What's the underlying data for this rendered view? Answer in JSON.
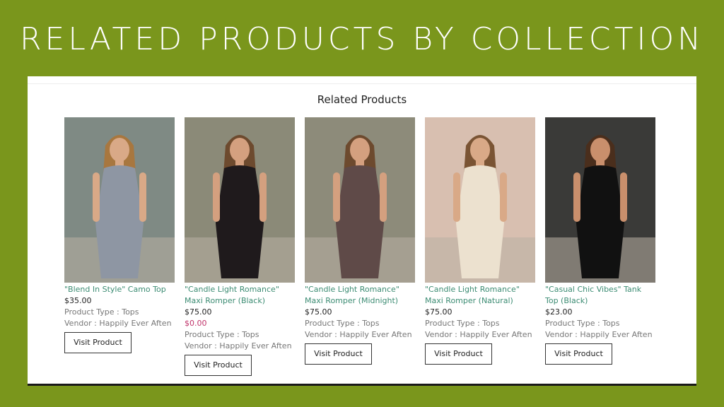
{
  "banner": {
    "title": "RELATED PRODUCTS BY COLLECTION"
  },
  "section": {
    "heading": "Related Products"
  },
  "products": [
    {
      "title": "\"Blend In Style\" Camo Top",
      "price": "$35.00",
      "compare_price": null,
      "product_type": "Product Type : Tops",
      "vendor": "Vendor : Happily Ever Aften",
      "button": "Visit Product",
      "colors": {
        "bg": "#7f8a84",
        "garment": "#8e96a3",
        "skin": "#d9a987",
        "hair": "#a8773f"
      }
    },
    {
      "title": "\"Candle Light Romance\" Maxi Romper (Black)",
      "price": "$75.00",
      "compare_price": "$0.00",
      "product_type": "Product Type : Tops",
      "vendor": "Vendor : Happily Ever Aften",
      "button": "Visit Product",
      "colors": {
        "bg": "#8b8a78",
        "garment": "#1f1a1c",
        "skin": "#d4a07f",
        "hair": "#6d4a2e"
      }
    },
    {
      "title": "\"Candle Light Romance\" Maxi Romper (Midnight)",
      "price": "$75.00",
      "compare_price": null,
      "product_type": "Product Type : Tops",
      "vendor": "Vendor : Happily Ever Aften",
      "button": "Visit Product",
      "colors": {
        "bg": "#8d8b7a",
        "garment": "#5f4a48",
        "skin": "#d4a07f",
        "hair": "#6d4a2e"
      }
    },
    {
      "title": "\"Candle Light Romance\" Maxi Romper (Natural)",
      "price": "$75.00",
      "compare_price": null,
      "product_type": "Product Type : Tops",
      "vendor": "Vendor : Happily Ever Aften",
      "button": "Visit Product",
      "colors": {
        "bg": "#d8bfb0",
        "garment": "#ece1cf",
        "skin": "#d9a987",
        "hair": "#7a5434"
      }
    },
    {
      "title": "\"Casual Chic Vibes\" Tank Top (Black)",
      "price": "$23.00",
      "compare_price": null,
      "product_type": "Product Type : Tops",
      "vendor": "Vendor : Happily Ever Aften",
      "button": "Visit Product",
      "colors": {
        "bg": "#3a3a38",
        "garment": "#111111",
        "skin": "#c98f6c",
        "hair": "#4a2e1c"
      }
    }
  ]
}
